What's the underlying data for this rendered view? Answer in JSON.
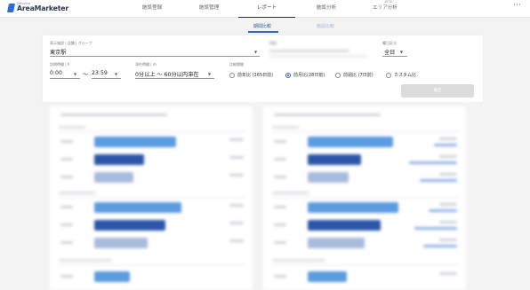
{
  "header": {
    "logo_small": "Dataview",
    "logo_big": "AreaMarketer",
    "nav": [
      {
        "label": "施設登録"
      },
      {
        "label": "施設管理"
      },
      {
        "label": "レポート"
      },
      {
        "label": "施設分析"
      },
      {
        "label": "エリア分析",
        "badge": "BETA"
      }
    ],
    "menu_icon": "kebab-menu-icon"
  },
  "subtabs": {
    "active": "期間比較",
    "inactive": "施設比較"
  },
  "filters": {
    "facility_label": "表示施設 | 店舗 | グループ",
    "facility_value": "東京駅",
    "period_label": "期間",
    "weekday_label": "曜日区分",
    "weekday_value": "全日",
    "time_label": "訪問時間 | h",
    "time_from": "0:00",
    "time_sep": "〜",
    "time_to": "23:59",
    "stay_label": "滞在時間 | m",
    "stay_value": "0分以上 〜 60分以内滞在",
    "compare_label": "比較期間",
    "compare_options": [
      {
        "label": "前年比 (365日前)",
        "selected": false
      },
      {
        "label": "前月比(28日前)",
        "selected": true
      },
      {
        "label": "前週比 (7日前)",
        "selected": false
      },
      {
        "label": "カスタム比",
        "selected": false
      }
    ],
    "confirm_label": "確定"
  },
  "colors": {
    "accent": "#2d5aa8",
    "bar_light": "#5b9be0",
    "bar_dark": "#2c55a8",
    "bar_pale": "#a9bcde"
  }
}
